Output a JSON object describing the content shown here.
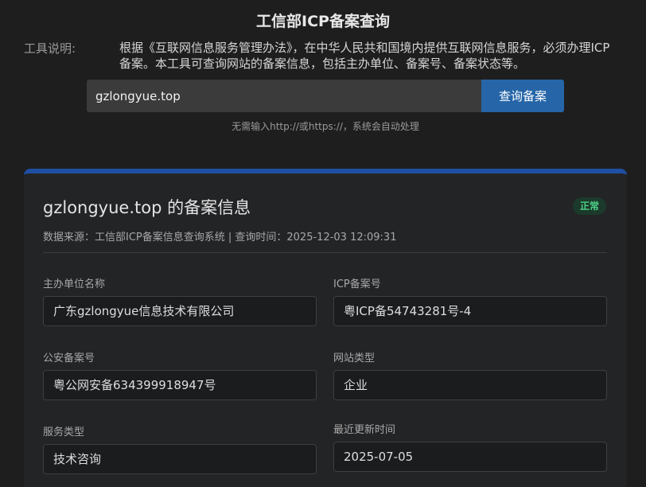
{
  "page": {
    "title": "工信部ICP备案查询",
    "description_label": "工具说明:",
    "description_text": "根据《互联网信息服务管理办法》，在中华人民共和国境内提供互联网信息服务，必须办理ICP备案。本工具可查询网站的备案信息，包括主办单位、备案号、备案状态等。"
  },
  "search": {
    "value": "gzlongyue.top",
    "placeholder": "",
    "button_label": "查询备案",
    "hint": "无需输入http://或https://，系统会自动处理"
  },
  "result": {
    "title": "gzlongyue.top 的备案信息",
    "status": "正常",
    "meta": "数据来源：工信部ICP备案信息查询系统 | 查询时间：2025-12-03 12:09:31",
    "status_color": "#4cd185",
    "accent_color": "#1f4fa3",
    "fields": [
      {
        "label": "主办单位名称",
        "value": "广东gzlongyue信息技术有限公司"
      },
      {
        "label": "ICP备案号",
        "value": "粤ICP备54743281号-4"
      },
      {
        "label": "公安备案号",
        "value": "粤公网安备634399918947号"
      },
      {
        "label": "网站类型",
        "value": "企业"
      },
      {
        "label": "服务类型",
        "value": "技术咨询"
      },
      {
        "label": "最近更新时间",
        "value": "2025-07-05"
      }
    ]
  }
}
